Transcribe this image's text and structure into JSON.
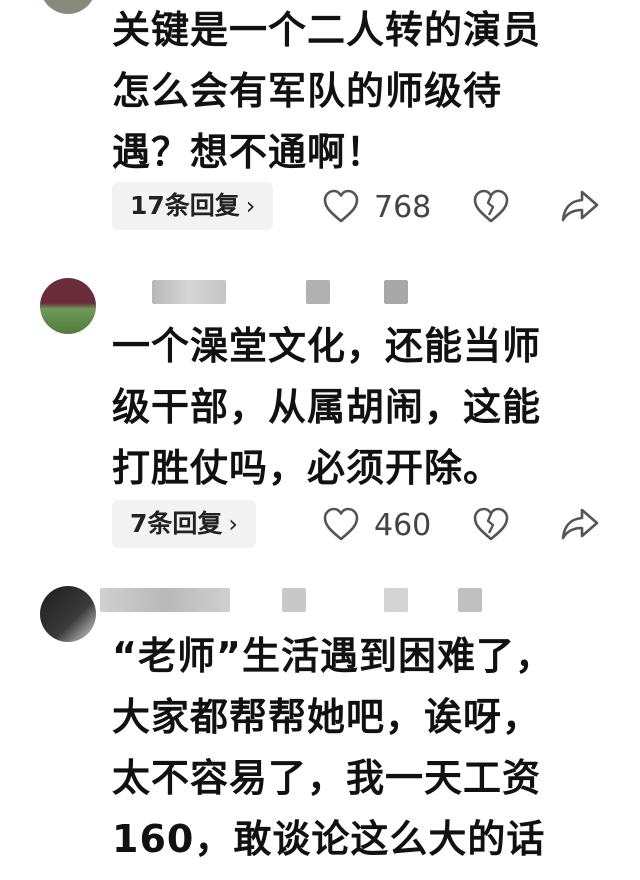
{
  "comments": [
    {
      "text": "关键是一个二人转的演员\n怎么会有军队的师级待\n遇？想不通啊！",
      "replies": "17条回复",
      "likes": "768"
    },
    {
      "text": "一个澡堂文化，还能当师\n级干部，从属胡闹，这能\n打胜仗吗，必须开除。",
      "replies": "7条回复",
      "likes": "460"
    },
    {
      "text": "“老师”生活遇到困难了，\n大家都帮帮她吧，诶呀，\n太不容易了，我一天工资\n160，敢谈论这么大的话"
    }
  ],
  "icons": {
    "reply_chevron": "chevron-right-icon",
    "like": "heart-outline-icon",
    "dislike": "broken-heart-icon",
    "share": "share-arrow-icon"
  },
  "colors": {
    "text": "#111111",
    "button_bg": "#f3f3f3",
    "icon": "#555555"
  }
}
